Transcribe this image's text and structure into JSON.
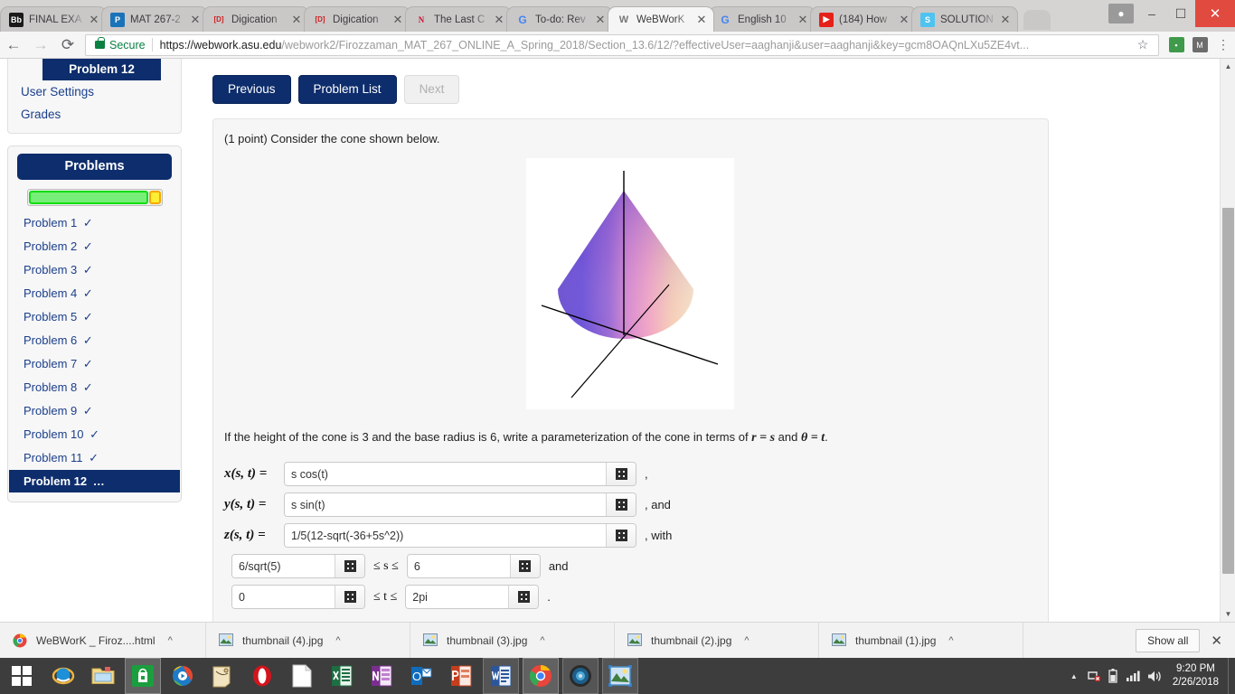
{
  "browser": {
    "tabs": [
      {
        "title": "FINAL EXA",
        "favicon": "blackboard-icon",
        "favicon_color": "#1a1a1a",
        "favicon_text": "Bb",
        "active": false
      },
      {
        "title": "MAT 267-2",
        "favicon": "pearson-icon",
        "favicon_color": "#1a73b8",
        "favicon_text": "P",
        "active": false
      },
      {
        "title": "Digication",
        "favicon": "digication-icon",
        "favicon_color": "#ffffff",
        "favicon_text": "[D]",
        "active": false
      },
      {
        "title": "Digication",
        "favicon": "digication-icon",
        "favicon_color": "#ffffff",
        "favicon_text": "[D]",
        "active": false
      },
      {
        "title": "The Last C",
        "favicon": "nebraska-n-icon",
        "favicon_color": "#ffffff",
        "favicon_text": "N",
        "active": false
      },
      {
        "title": "To-do: Rev",
        "favicon": "google-icon",
        "favicon_color": "#ffffff",
        "favicon_text": "G",
        "active": false
      },
      {
        "title": "WeBWorK",
        "favicon": "webwork-spider-icon",
        "favicon_color": "#ffffff",
        "favicon_text": "W",
        "active": true
      },
      {
        "title": "English 10",
        "favicon": "google-icon",
        "favicon_color": "#ffffff",
        "favicon_text": "G",
        "active": false
      },
      {
        "title": "(184) How",
        "favicon": "youtube-icon",
        "favicon_color": "#e62117",
        "favicon_text": "▶",
        "active": false
      },
      {
        "title": "SOLUTION",
        "favicon": "studypool-icon",
        "favicon_color": "#4ec3f0",
        "favicon_text": "S",
        "active": false
      }
    ],
    "close_label": "✕",
    "new_tab_label": "",
    "window_controls": {
      "profile": "●",
      "minimize": "–",
      "restore": "❐",
      "close": "✕"
    },
    "nav": {
      "back": "←",
      "forward": "→",
      "reload": "↻"
    },
    "address": {
      "security_label": "Secure",
      "url_host": "https://webwork.asu.edu",
      "url_path": "/webwork2/Firozzaman_MAT_267_ONLINE_A_Spring_2018/Section_13.6/12/?effectiveUser=aaghanji&user=aaghanji&key=gcm8OAQnLXu5ZE4vt...",
      "bookmark_icon": "star-icon"
    },
    "toolbar_extensions": [
      {
        "name": "extension-one",
        "glyph": "▮",
        "color": "#3f9a4b"
      },
      {
        "name": "extension-two",
        "glyph": "Ⓜ",
        "color": "#5a5a5a"
      }
    ],
    "menu_label": "⋮"
  },
  "sidebar": {
    "nav": {
      "current_problem": "Problem 12",
      "links": [
        "User Settings",
        "Grades"
      ]
    },
    "problems_header": "Problems",
    "progress": {
      "green_percent": 91,
      "yellow_percent": 9,
      "green_color": "#77ee77",
      "yellow_color": "#ffee33"
    },
    "problems": [
      {
        "label": "Problem 1",
        "status": "✓",
        "current": false
      },
      {
        "label": "Problem 2",
        "status": "✓",
        "current": false
      },
      {
        "label": "Problem 3",
        "status": "✓",
        "current": false
      },
      {
        "label": "Problem 4",
        "status": "✓",
        "current": false
      },
      {
        "label": "Problem 5",
        "status": "✓",
        "current": false
      },
      {
        "label": "Problem 6",
        "status": "✓",
        "current": false
      },
      {
        "label": "Problem 7",
        "status": "✓",
        "current": false
      },
      {
        "label": "Problem 8",
        "status": "✓",
        "current": false
      },
      {
        "label": "Problem 9",
        "status": "✓",
        "current": false
      },
      {
        "label": "Problem 10",
        "status": "✓",
        "current": false
      },
      {
        "label": "Problem 11",
        "status": "✓",
        "current": false
      },
      {
        "label": "Problem 12",
        "status": "…",
        "current": true
      }
    ]
  },
  "main": {
    "buttons": {
      "previous": "Previous",
      "problem_list": "Problem List",
      "next": "Next"
    },
    "points_text": "(1 point) Consider the cone shown below.",
    "figure_name": "cone-3d-plot",
    "question_pre": "If the height of the cone is 3 and the base radius is 6, write a parameterization of the cone in terms of ",
    "question_r": "r = s",
    "question_and": " and ",
    "question_theta": "θ = t",
    "question_post": ".",
    "answers": [
      {
        "label": "x(s, t) =",
        "value": "s cos(t)",
        "tail": ","
      },
      {
        "label": "y(s, t) =",
        "value": "s sin(t)",
        "tail": ", and"
      },
      {
        "label": "z(s, t) =",
        "value": "1/5(12-sqrt(-36+5s^2))",
        "tail": ", with"
      }
    ],
    "ranges": [
      {
        "lower": "6/sqrt(5)",
        "middle": "≤ s ≤",
        "upper": "6",
        "tail": "and"
      },
      {
        "lower": "0",
        "middle": "≤ t ≤",
        "upper": "2pi",
        "tail": "."
      }
    ],
    "keypad_icon": "keypad-grid-icon"
  },
  "downloads": {
    "items": [
      {
        "name": "WeBWorK _ Firoz....html",
        "icon": "chrome-file-icon"
      },
      {
        "name": "thumbnail (4).jpg",
        "icon": "image-file-icon"
      },
      {
        "name": "thumbnail (3).jpg",
        "icon": "image-file-icon"
      },
      {
        "name": "thumbnail (2).jpg",
        "icon": "image-file-icon"
      },
      {
        "name": "thumbnail (1).jpg",
        "icon": "image-file-icon"
      }
    ],
    "caret": "^",
    "show_all": "Show all",
    "close": "✕"
  },
  "taskbar": {
    "start_icon": "windows-start-icon",
    "items": [
      {
        "name": "internet-explorer-icon",
        "state": "pinned"
      },
      {
        "name": "file-explorer-icon",
        "state": "pinned"
      },
      {
        "name": "microsoft-store-icon",
        "state": "active"
      },
      {
        "name": "media-player-icon",
        "state": "pinned"
      },
      {
        "name": "sticky-notes-icon",
        "state": "pinned"
      },
      {
        "name": "opera-icon",
        "state": "pinned"
      },
      {
        "name": "document-icon",
        "state": "pinned"
      },
      {
        "name": "excel-icon",
        "state": "pinned"
      },
      {
        "name": "onenote-icon",
        "state": "pinned"
      },
      {
        "name": "outlook-icon",
        "state": "pinned"
      },
      {
        "name": "powerpoint-icon",
        "state": "pinned"
      },
      {
        "name": "word-icon",
        "state": "running"
      },
      {
        "name": "chrome-icon",
        "state": "active"
      },
      {
        "name": "disc-utility-icon",
        "state": "running"
      },
      {
        "name": "photos-icon",
        "state": "running"
      }
    ],
    "tray": [
      {
        "name": "show-hidden-icons-arrow",
        "glyph": "▲"
      },
      {
        "name": "network-problem-icon",
        "glyph": "🖳"
      },
      {
        "name": "battery-icon",
        "glyph": "▌"
      },
      {
        "name": "signal-bars-icon",
        "glyph": "▃"
      },
      {
        "name": "volume-icon",
        "glyph": "🔊"
      }
    ],
    "time": "9:20 PM",
    "date": "2/26/2018"
  }
}
